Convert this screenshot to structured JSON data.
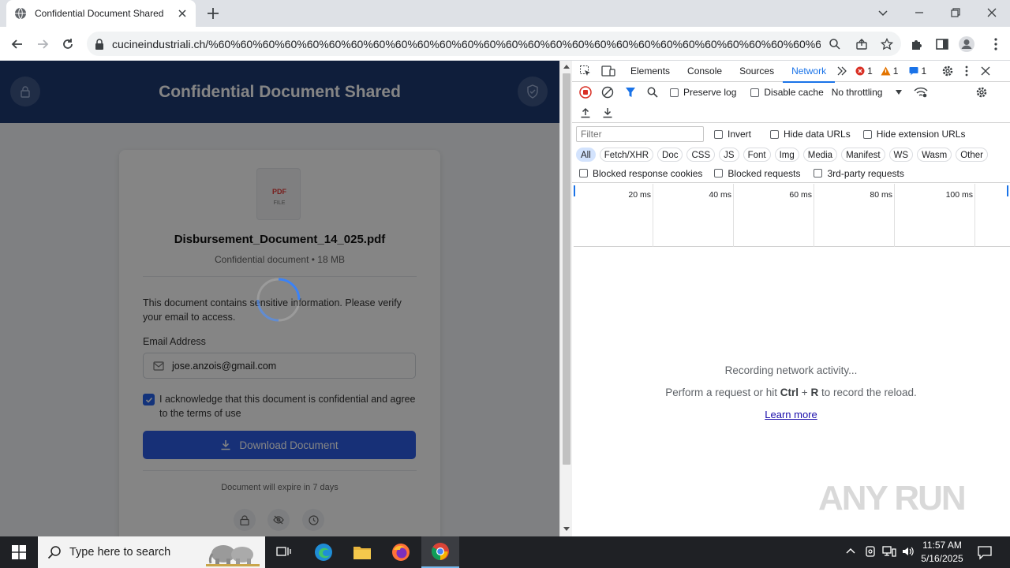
{
  "browser": {
    "tab_title": "Confidential Document Shared",
    "url": "cucineindustriali.ch/%60%60%60%60%60%60%60%60%60%60%60%60%60%60%60%60%60%60%60%60%60%60%60%60%60%60%60%60%60%60%60%60%..."
  },
  "page": {
    "banner_title": "Confidential Document Shared",
    "file_icon_text": "PDF",
    "file_icon_subtext": "FILE",
    "file_name": "Disbursement_Document_14_025.pdf",
    "file_meta": "Confidential document • 18 MB",
    "message": "This document contains sensitive information. Please verify your email to access.",
    "email_label": "Email Address",
    "email_value": "jose.anzois@gmail.com",
    "ack_text": "I acknowledge that this document is confidential and agree to the terms of use",
    "ack_checked": true,
    "download_label": "Download Document",
    "expire_text": "Document will expire in 7 days"
  },
  "devtools": {
    "tabs": [
      "Elements",
      "Console",
      "Sources",
      "Network"
    ],
    "active_tab": "Network",
    "error_count": "1",
    "warning_count": "1",
    "message_count": "1",
    "preserve_log": "Preserve log",
    "disable_cache": "Disable cache",
    "throttling": "No throttling",
    "filter_placeholder": "Filter",
    "invert": "Invert",
    "hide_data_urls": "Hide data URLs",
    "hide_extension_urls": "Hide extension URLs",
    "type_filters": [
      "All",
      "Fetch/XHR",
      "Doc",
      "CSS",
      "JS",
      "Font",
      "Img",
      "Media",
      "Manifest",
      "WS",
      "Wasm",
      "Other"
    ],
    "blocked_response_cookies": "Blocked response cookies",
    "blocked_requests": "Blocked requests",
    "third_party": "3rd-party requests",
    "timeline_labels": [
      "20 ms",
      "40 ms",
      "60 ms",
      "80 ms",
      "100 ms"
    ],
    "empty_line1": "Recording network activity...",
    "empty_line2_pre": "Perform a request or hit ",
    "empty_line2_key1": "Ctrl",
    "empty_line2_plus": " + ",
    "empty_line2_key2": "R",
    "empty_line2_post": " to record the reload.",
    "learn_more": "Learn more"
  },
  "watermark": "ANY RUN",
  "taskbar": {
    "search_placeholder": "Type here to search",
    "time": "11:57 AM",
    "date": "5/16/2025"
  },
  "colors": {
    "banner": "#1e3a72",
    "accent": "#2c5de5",
    "devtools_active": "#1a73e8"
  }
}
